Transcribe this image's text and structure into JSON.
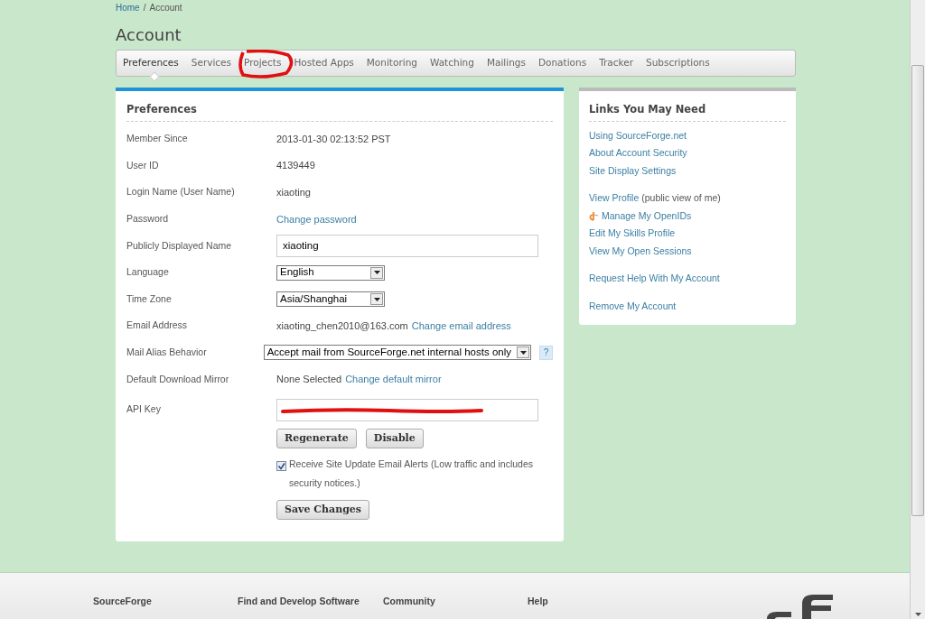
{
  "breadcrumb": [
    {
      "text": "Home",
      "kind": "link",
      "separator": "/"
    },
    {
      "text": "Account",
      "kind": "current"
    }
  ],
  "title": "Account",
  "tabs": [
    {
      "label": "Preferences",
      "selected": true,
      "circled": false
    },
    {
      "label": "Services",
      "selected": false,
      "circled": false
    },
    {
      "label": "Projects",
      "selected": false,
      "circled": true
    },
    {
      "label": "Hosted Apps",
      "selected": false,
      "circled": false
    },
    {
      "label": "Monitoring",
      "selected": false,
      "circled": false
    },
    {
      "label": "Watching",
      "selected": false,
      "circled": false
    },
    {
      "label": "Mailings",
      "selected": false,
      "circled": false
    },
    {
      "label": "Donations",
      "selected": false,
      "circled": false
    },
    {
      "label": "Tracker",
      "selected": false,
      "circled": false
    },
    {
      "label": "Subscriptions",
      "selected": false,
      "circled": false
    }
  ],
  "preferences": {
    "heading": "Preferences",
    "rows": [
      {
        "kind": "text",
        "label": "Member Since",
        "value": "2013-01-30 02:13:52 PST"
      },
      {
        "kind": "text",
        "label": "User ID",
        "value": "4139449"
      },
      {
        "kind": "text",
        "label": "Login Name (User Name)",
        "value": "xiaoting"
      },
      {
        "kind": "link",
        "label": "Password",
        "link": "Change password"
      },
      {
        "kind": "input",
        "label": "Publicly Displayed Name",
        "value": "xiaoting"
      },
      {
        "kind": "select",
        "label": "Language",
        "value": "English"
      },
      {
        "kind": "select",
        "label": "Time Zone",
        "value": "Asia/Shanghai"
      },
      {
        "kind": "text_link",
        "label": "Email Address",
        "value": "xiaoting_chen2010@163.com",
        "link": "Change email address"
      },
      {
        "kind": "select_help",
        "label": "Mail Alias Behavior",
        "value": "Accept mail from SourceForge.net internal hosts only",
        "help": "?"
      },
      {
        "kind": "text_link",
        "label": "Default Download Mirror",
        "value": "None Selected",
        "link": "Change default mirror"
      },
      {
        "kind": "api_key",
        "label": "API Key",
        "scribbled": true,
        "buttons": [
          "Regenerate",
          "Disable"
        ]
      }
    ],
    "alerts": {
      "checked": true,
      "label": "Receive Site Update Email Alerts (Low traffic and includes security notices.)"
    },
    "save": "Save Changes"
  },
  "links": {
    "heading": "Links You May Need",
    "groups": [
      [
        {
          "kind": "link",
          "text": "Using SourceForge.net"
        },
        {
          "kind": "link",
          "text": "About Account Security"
        },
        {
          "kind": "link",
          "text": "Site Display Settings"
        }
      ],
      [
        {
          "kind": "link",
          "text": "View Profile",
          "note": "(public view of me)"
        },
        {
          "kind": "openid",
          "text": "Manage My OpenIDs"
        },
        {
          "kind": "link",
          "text": "Edit My Skills Profile"
        },
        {
          "kind": "link",
          "text": "View My Open Sessions"
        }
      ],
      [
        {
          "kind": "link",
          "text": "Request Help With My Account"
        }
      ],
      [
        {
          "kind": "link",
          "text": "Remove My Account"
        }
      ]
    ]
  },
  "footer": {
    "columns": [
      "SourceForge",
      "Find and Develop Software",
      "Community",
      "Help"
    ]
  }
}
